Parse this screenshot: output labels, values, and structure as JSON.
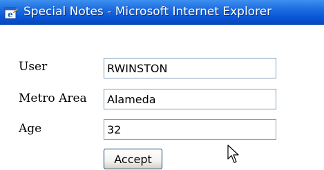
{
  "window": {
    "title": "Special Notes - Microsoft Internet Explorer",
    "icon": "internet-explorer-icon",
    "title_bar_color": "#0a55d8"
  },
  "form": {
    "user": {
      "label": "User",
      "value": "RWINSTON"
    },
    "metro_area": {
      "label": "Metro Area",
      "value": "Alameda"
    },
    "age": {
      "label": "Age",
      "value": "32"
    },
    "accept_label": "Accept"
  },
  "pointer": {
    "icon": "mouse-pointer-icon"
  }
}
